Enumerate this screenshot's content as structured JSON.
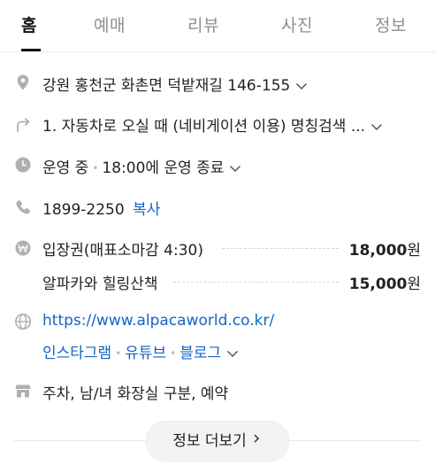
{
  "tabs": [
    {
      "label": "홈",
      "active": true
    },
    {
      "label": "예매",
      "active": false
    },
    {
      "label": "리뷰",
      "active": false
    },
    {
      "label": "사진",
      "active": false
    },
    {
      "label": "정보",
      "active": false
    }
  ],
  "address": {
    "text": "강원 홍천군 화촌면 덕밭재길 146-155",
    "icon": "location-pin-icon"
  },
  "directions": {
    "text": "1. 자동차로 오실 때 (네비게이션 이용) 명칭검색 ...",
    "icon": "directions-arrow-icon"
  },
  "hours": {
    "status": "운영 중",
    "detail": "18:00에 운영 종료",
    "icon": "clock-icon"
  },
  "phone": {
    "number": "1899-2250",
    "copy_label": "복사",
    "icon": "phone-icon"
  },
  "prices": {
    "icon": "won-currency-icon",
    "items": [
      {
        "name": "입장권(매표소마감 4:30)",
        "amount": "18,000",
        "unit": "원"
      },
      {
        "name": "알파카와 힐링산책",
        "amount": "15,000",
        "unit": "원"
      }
    ]
  },
  "web": {
    "icon": "globe-icon",
    "url": "https://www.alpacaworld.co.kr/",
    "social": [
      "인스타그램",
      "유튜브",
      "블로그"
    ]
  },
  "facilities": {
    "text": "주차, 남/녀 화장실 구분, 예약",
    "icon": "store-icon"
  },
  "more_button": {
    "label": "정보 더보기"
  },
  "colors": {
    "link": "#1464c8",
    "icon": "#b0b0b0",
    "active_tab": "#111111",
    "inactive_tab": "#8f8f8f"
  }
}
